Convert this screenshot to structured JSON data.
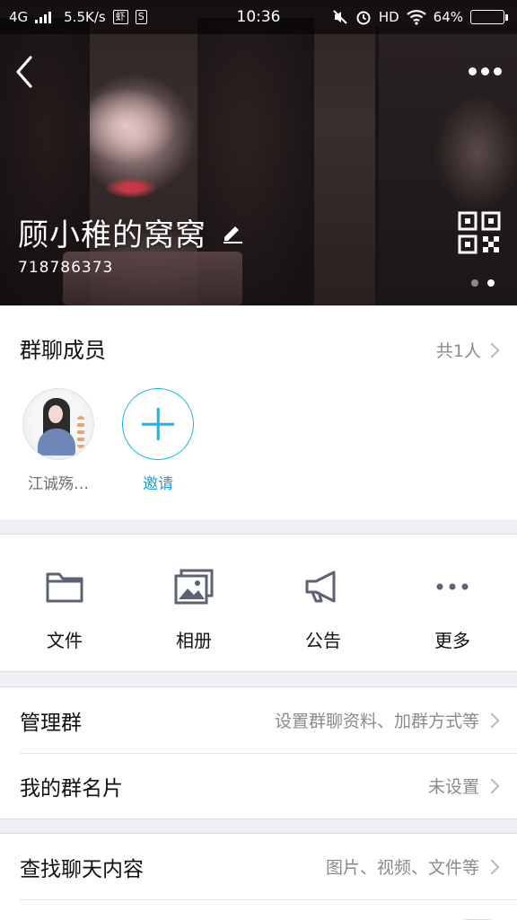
{
  "status_bar": {
    "network": "4G",
    "speed": "5.5K/s",
    "app_badge_1": "虾",
    "app_badge_2": "S",
    "time": "10:36",
    "hd": "HD",
    "battery_text": "64%",
    "battery_level": 0.64
  },
  "header": {
    "group_name": "顾小稚的窝窝",
    "group_id": "718786373",
    "page_indicator": {
      "count": 2,
      "active": 2
    }
  },
  "members": {
    "title": "群聊成员",
    "count_label": "共1人",
    "list": [
      {
        "name": "江诚殇…"
      },
      {
        "name": "邀请"
      }
    ]
  },
  "tools": [
    {
      "label": "文件",
      "icon": "folder-icon"
    },
    {
      "label": "相册",
      "icon": "album-icon"
    },
    {
      "label": "公告",
      "icon": "megaphone-icon"
    },
    {
      "label": "更多",
      "icon": "more-dots-icon"
    }
  ],
  "settings": {
    "manage_group": {
      "label": "管理群",
      "value": "设置群聊资料、加群方式等"
    },
    "my_card": {
      "label": "我的群名片",
      "value": "未设置"
    },
    "search_chat": {
      "label": "查找聊天内容",
      "value": "图片、视频、文件等"
    }
  },
  "colors": {
    "accent": "#12b7f5",
    "invite_text": "#1a9fde",
    "background": "#efeff4"
  }
}
